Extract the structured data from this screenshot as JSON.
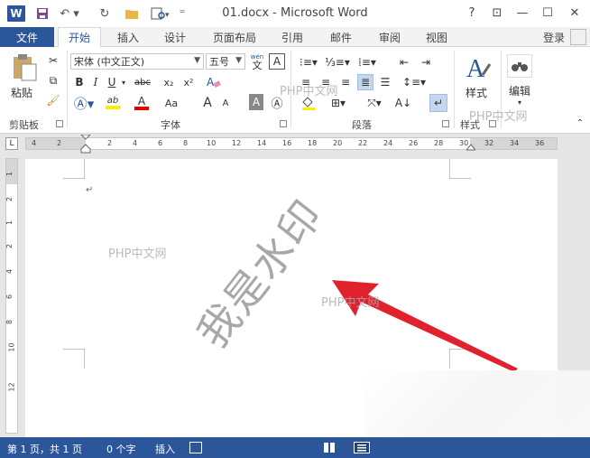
{
  "window": {
    "title": "01.docx - Microsoft Word",
    "logo_letter": "W",
    "help": "?",
    "restore_ribbon": "⊡",
    "minimize": "—",
    "maximize": "☐",
    "close": "✕"
  },
  "tabs": {
    "file": "文件",
    "items": [
      "开始",
      "插入",
      "设计",
      "页面布局",
      "引用",
      "邮件",
      "审阅",
      "视图"
    ],
    "active": "开始",
    "login": "登录"
  },
  "ribbon": {
    "clipboard": {
      "paste_label": "粘贴",
      "group_label": "剪贴板"
    },
    "font": {
      "font_name": "宋体 (中文正文)",
      "font_size": "五号",
      "wen_label": "wén",
      "wen_char": "文",
      "a_box": "A",
      "bold": "B",
      "italic": "I",
      "underline": "U",
      "strike": "abc",
      "subscript": "x₂",
      "superscript": "x²",
      "grow": "A",
      "shrink": "A",
      "case": "Aa",
      "highlight": "ab",
      "color": "A",
      "char_shade": "A",
      "char_border": "Ⓐ",
      "group_label": "字体"
    },
    "paragraph": {
      "group_label": "段落"
    },
    "styles": {
      "label": "样式",
      "group_label": "样式"
    },
    "editing": {
      "label": "编辑"
    },
    "colors": {
      "highlight_yellow": "#ffeb00",
      "font_red": "#e00000",
      "accent": "#2b579a"
    }
  },
  "ruler": {
    "h_numbers": [
      "4",
      "2",
      "2",
      "4",
      "6",
      "8",
      "10",
      "12",
      "14",
      "16",
      "18",
      "20",
      "22",
      "24",
      "26",
      "28",
      "30",
      "32",
      "34",
      "36"
    ],
    "v_numbers": [
      "1",
      "2",
      "1",
      "2",
      "4",
      "6",
      "8",
      "10",
      "12"
    ]
  },
  "document": {
    "watermark_text": "我是水印",
    "paragraph_mark": "↵",
    "overlay_watermarks": [
      "PHP中文网",
      "PHP中文网",
      "PHP中文网",
      "PHP中文网"
    ]
  },
  "status": {
    "pages": "第 1 页，共 1 页",
    "words": "0 个字",
    "mode": "插入"
  }
}
